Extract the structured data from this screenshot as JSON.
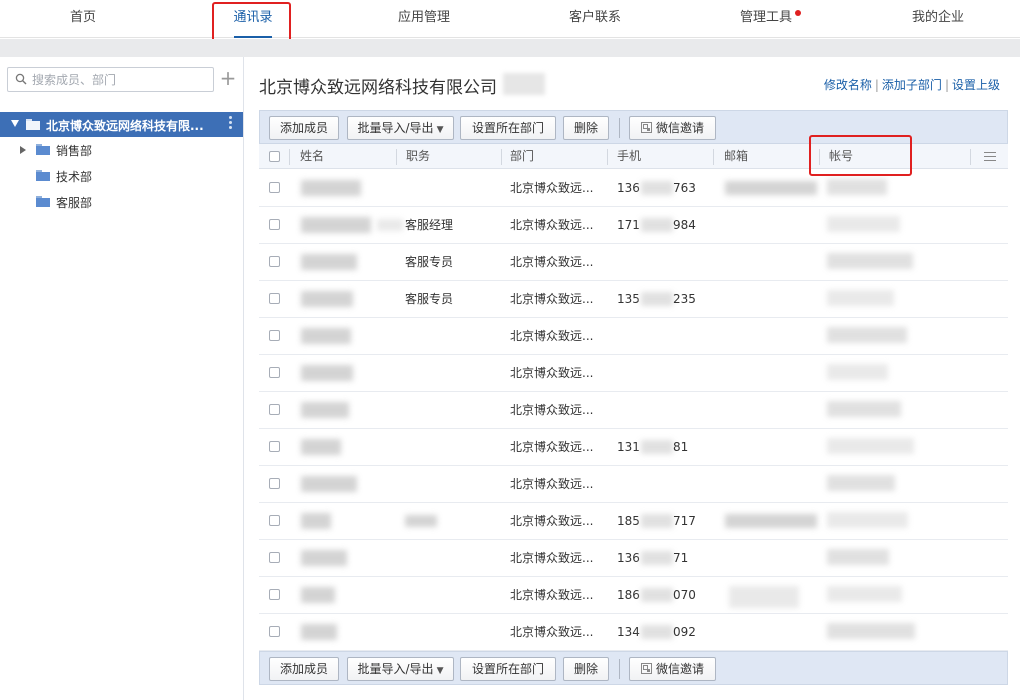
{
  "topnav": {
    "items": [
      {
        "label": "首页",
        "active": false
      },
      {
        "label": "通讯录",
        "active": true
      },
      {
        "label": "应用管理",
        "active": false
      },
      {
        "label": "客户联系",
        "active": false
      },
      {
        "label": "管理工具",
        "active": false,
        "badge": true
      },
      {
        "label": "我的企业",
        "active": false
      }
    ]
  },
  "sidebar": {
    "search_placeholder": "搜索成员、部门",
    "root": "北京博众致远网络科技有限...",
    "departments": [
      "销售部",
      "技术部",
      "客服部"
    ]
  },
  "main": {
    "company_name": "北京博众致远网络科技有限公司",
    "actions": [
      "修改名称",
      "添加子部门",
      "设置上级"
    ]
  },
  "toolbar": {
    "add_member": "添加成员",
    "import_export": "批量导入/导出",
    "set_dept": "设置所在部门",
    "delete": "删除",
    "wechat_invite": "微信邀请"
  },
  "table": {
    "columns": [
      "姓名",
      "职务",
      "部门",
      "手机",
      "邮箱",
      "帐号"
    ],
    "rows": [
      {
        "position": "",
        "dept": "北京博众致远...",
        "phone_a": "136",
        "phone_b": "763"
      },
      {
        "position": "客服经理",
        "dept": "北京博众致远...",
        "phone_a": "171",
        "phone_b": "984"
      },
      {
        "position": "客服专员",
        "dept": "北京博众致远...",
        "phone_a": "",
        "phone_b": ""
      },
      {
        "position": "客服专员",
        "dept": "北京博众致远...",
        "phone_a": "135",
        "phone_b": "235"
      },
      {
        "position": "",
        "dept": "北京博众致远...",
        "phone_a": "",
        "phone_b": ""
      },
      {
        "position": "",
        "dept": "北京博众致远...",
        "phone_a": "",
        "phone_b": ""
      },
      {
        "position": "",
        "dept": "北京博众致远...",
        "phone_a": "",
        "phone_b": ""
      },
      {
        "position": "",
        "dept": "北京博众致远...",
        "phone_a": "131",
        "phone_b": "81"
      },
      {
        "position": "",
        "dept": "北京博众致远...",
        "phone_a": "",
        "phone_b": ""
      },
      {
        "position": "",
        "dept": "北京博众致远...",
        "phone_a": "185",
        "phone_b": "717"
      },
      {
        "position": "",
        "dept": "北京博众致远...",
        "phone_a": "136",
        "phone_b": "71"
      },
      {
        "position": "",
        "dept": "北京博众致远...",
        "phone_a": "186",
        "phone_b": "070"
      },
      {
        "position": "",
        "dept": "北京博众致远...",
        "phone_a": "134",
        "phone_b": "092"
      }
    ]
  },
  "colors": {
    "accent": "#1a5fa8",
    "selected_tree": "#3d6fb6",
    "toolbar_bg": "#dfe7f4",
    "highlight": "#e02020"
  }
}
